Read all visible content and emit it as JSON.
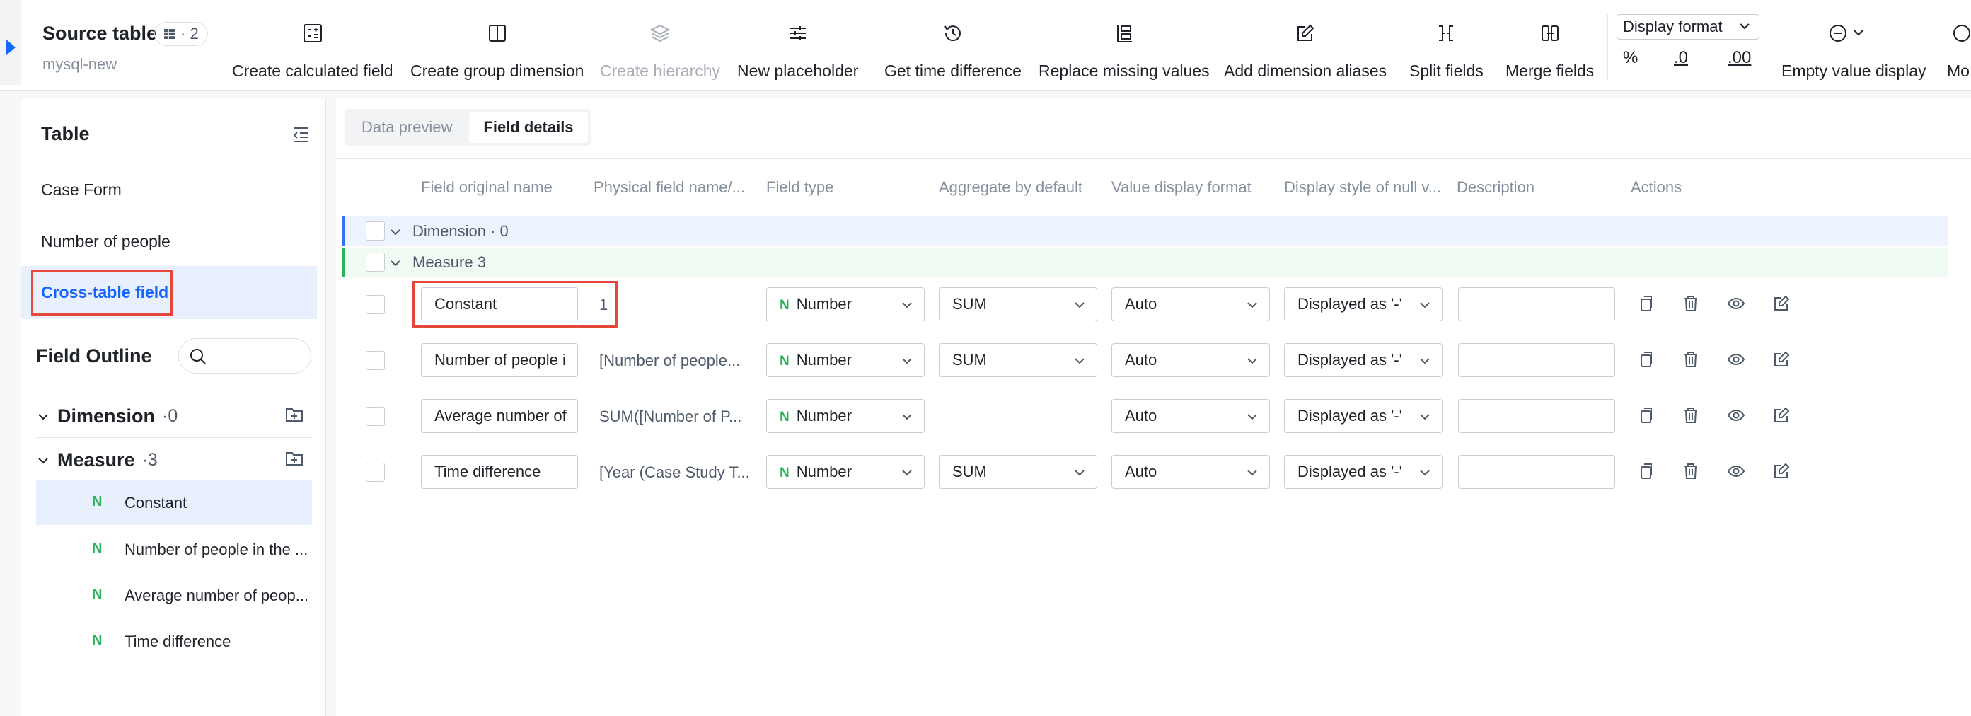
{
  "toolbar": {
    "source_title": "Source table",
    "source_badge_count": "· 2",
    "source_subtitle": "mysql-new",
    "buttons": [
      {
        "label": "Create calculated field",
        "icon": "calculator-icon",
        "enabled": true
      },
      {
        "label": "Create group dimension",
        "icon": "columns-icon",
        "enabled": true
      },
      {
        "label": "Create hierarchy",
        "icon": "layers-icon",
        "enabled": false
      },
      {
        "label": "New placeholder",
        "icon": "sliders-icon",
        "enabled": true
      },
      {
        "label": "Get time difference",
        "icon": "clock-icon",
        "enabled": true
      },
      {
        "label": "Replace missing values",
        "icon": "replace-icon",
        "enabled": true
      },
      {
        "label": "Add dimension aliases",
        "icon": "edit-icon",
        "enabled": true
      },
      {
        "label": "Split fields",
        "icon": "split-icon",
        "enabled": true
      },
      {
        "label": "Merge fields",
        "icon": "merge-icon",
        "enabled": true
      },
      {
        "label": "Empty value display",
        "icon": "minus-circle-icon",
        "enabled": true
      },
      {
        "label": "Mo",
        "icon": "more-icon",
        "enabled": true
      }
    ],
    "display_format_label": "Display format",
    "format_icons": [
      "%",
      ".0",
      ".00"
    ]
  },
  "left_panel": {
    "title": "Table",
    "tables": [
      "Case Form",
      "Number of people",
      "Cross-table field"
    ],
    "active_table": "Cross-table field",
    "field_outline_title": "Field Outline",
    "groups": [
      {
        "name": "Dimension",
        "count": "·0"
      },
      {
        "name": "Measure",
        "count": "·3"
      }
    ],
    "measure_fields": [
      {
        "name": "Constant",
        "type_icon": "N",
        "active": true
      },
      {
        "name": "Number of people in the ...",
        "type_icon": "N",
        "active": false
      },
      {
        "name": "Average number of peop...",
        "type_icon": "N",
        "active": false
      },
      {
        "name": "Time difference",
        "type_icon": "N",
        "active": false
      }
    ]
  },
  "main": {
    "tabs": [
      "Data preview",
      "Field details"
    ],
    "active_tab": "Field details",
    "columns": [
      "Field original name",
      "Physical field name/...",
      "Field type",
      "Aggregate by default",
      "Value display format",
      "Display style of null v...",
      "Description",
      "Actions"
    ],
    "groups": [
      {
        "label": "Dimension · 0",
        "color": "#3370ff"
      },
      {
        "label": "Measure 3",
        "color": "#2bb35b"
      }
    ],
    "rows": [
      {
        "original_name": "Constant",
        "physical_name": "1",
        "type": "Number",
        "aggregate": "SUM",
        "format": "Auto",
        "null_style": "Displayed as '-'",
        "description": ""
      },
      {
        "original_name": "Number of people i",
        "physical_name": "[Number of people...",
        "type": "Number",
        "aggregate": "SUM",
        "format": "Auto",
        "null_style": "Displayed as '-'",
        "description": ""
      },
      {
        "original_name": "Average number of",
        "physical_name": "SUM([Number of P...",
        "type": "Number",
        "aggregate": "",
        "format": "Auto",
        "null_style": "Displayed as '-'",
        "description": ""
      },
      {
        "original_name": "Time difference",
        "physical_name": "[Year (Case Study T...",
        "type": "Number",
        "aggregate": "SUM",
        "format": "Auto",
        "null_style": "Displayed as '-'",
        "description": ""
      }
    ],
    "type_icon": "N"
  },
  "colors": {
    "accent": "#1664ff",
    "highlight_box": "#e5473b",
    "number_icon": "#2bb35b"
  }
}
